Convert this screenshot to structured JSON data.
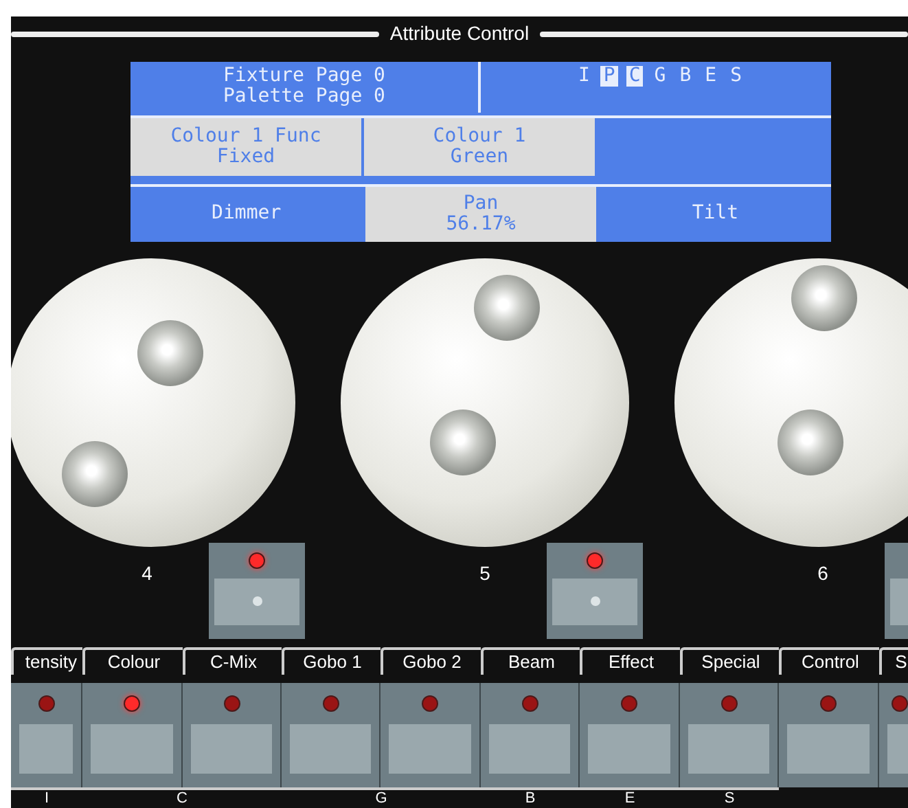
{
  "window": {
    "title": "Attribute Control"
  },
  "info": {
    "fixture_page": "Fixture Page 0",
    "palette_page": "Palette Page 0",
    "attribute_groups": [
      {
        "label": "I",
        "selected": false
      },
      {
        "label": "P",
        "selected": true
      },
      {
        "label": "C",
        "selected": true
      },
      {
        "label": "G",
        "selected": false
      },
      {
        "label": "B",
        "selected": false
      },
      {
        "label": "E",
        "selected": false
      },
      {
        "label": "S",
        "selected": false
      }
    ]
  },
  "parameters": [
    {
      "name": "Colour 1 Func",
      "value": "Fixed"
    },
    {
      "name": "Colour 1",
      "value": "Green"
    }
  ],
  "wheels": [
    {
      "label": "Dimmer",
      "active": false
    },
    {
      "label": "Pan",
      "value": "56.17%",
      "active": true
    },
    {
      "label": "Tilt",
      "active": false
    }
  ],
  "encoders": [
    {
      "number": "4",
      "led_on": true
    },
    {
      "number": "5",
      "led_on": true
    },
    {
      "number": "6"
    }
  ],
  "attribute_tabs": [
    {
      "label": "tensity",
      "led_on": false
    },
    {
      "label": "Colour",
      "led_on": true
    },
    {
      "label": "C-Mix",
      "led_on": false
    },
    {
      "label": "Gobo 1",
      "led_on": false
    },
    {
      "label": "Gobo 2",
      "led_on": false
    },
    {
      "label": "Beam",
      "led_on": false
    },
    {
      "label": "Effect",
      "led_on": false
    },
    {
      "label": "Special",
      "led_on": false
    },
    {
      "label": "Control",
      "led_on": false
    },
    {
      "label": "S",
      "led_on": false
    }
  ],
  "groups": [
    "I",
    "C",
    "G",
    "B",
    "E",
    "S"
  ]
}
